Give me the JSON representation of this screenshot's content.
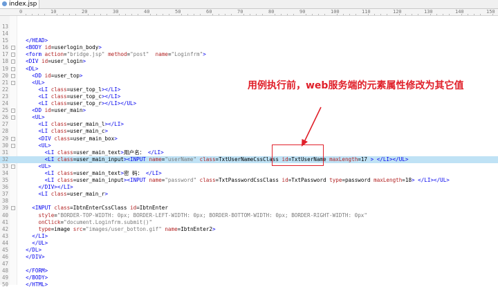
{
  "tab": {
    "filename": "index.jsp",
    "icon": "jsp-file-icon"
  },
  "ruler": {
    "ticks": [
      "0",
      "10",
      "20",
      "30",
      "40",
      "50",
      "60",
      "70",
      "80",
      "90",
      "100",
      "110",
      "120",
      "130",
      "140",
      "150"
    ]
  },
  "annotation": {
    "text": "用例执行前，web服务端的元素属性修改为其它值",
    "color": "#e0202a"
  },
  "highlight_color": "#bfe2f5",
  "lines": [
    {
      "num": "13",
      "fold": "",
      "html": ""
    },
    {
      "num": "14",
      "fold": "",
      "html": ""
    },
    {
      "num": "15",
      "fold": "",
      "html": "  <span class=\"t\">&lt;/HEAD&gt;</span>"
    },
    {
      "num": "16",
      "fold": "-",
      "html": "  <span class=\"t\">&lt;BODY</span> <span class=\"a\">id</span>=userlogin_body<span class=\"t\">&gt;</span>"
    },
    {
      "num": "17",
      "fold": "-",
      "html": "  <span class=\"t\">&lt;form</span> <span class=\"a\">action</span>=<span class=\"v\">\"bridge.jsp\"</span> <span class=\"a\">method</span>=<span class=\"v\">\"post\"</span>  <span class=\"a\">name</span>=<span class=\"v\">\"Loginfrm\"</span><span class=\"t\">&gt;</span>"
    },
    {
      "num": "18",
      "fold": "-",
      "html": "  <span class=\"t\">&lt;DIV</span> <span class=\"a\">id</span>=user_login<span class=\"t\">&gt;</span>"
    },
    {
      "num": "19",
      "fold": "-",
      "html": "  <span class=\"t\">&lt;DL&gt;</span>"
    },
    {
      "num": "20",
      "fold": "-",
      "html": "    <span class=\"t\">&lt;DD</span> <span class=\"a\">id</span>=user_top<span class=\"t\">&gt;</span>"
    },
    {
      "num": "21",
      "fold": "-",
      "html": "    <span class=\"t\">&lt;UL&gt;</span>"
    },
    {
      "num": "22",
      "fold": "",
      "html": "      <span class=\"t\">&lt;LI</span> <span class=\"a\">class</span>=user_top_l<span class=\"t\">&gt;&lt;/LI&gt;</span>"
    },
    {
      "num": "23",
      "fold": "",
      "html": "      <span class=\"t\">&lt;LI</span> <span class=\"a\">class</span>=user_top_c<span class=\"t\">&gt;&lt;/LI&gt;</span>"
    },
    {
      "num": "24",
      "fold": "",
      "html": "      <span class=\"t\">&lt;LI</span> <span class=\"a\">class</span>=user_top_r<span class=\"t\">&gt;&lt;/LI&gt;&lt;/UL&gt;</span>"
    },
    {
      "num": "25",
      "fold": "-",
      "html": "    <span class=\"t\">&lt;DD</span> <span class=\"a\">id</span>=user_main<span class=\"t\">&gt;</span>"
    },
    {
      "num": "26",
      "fold": "-",
      "html": "    <span class=\"t\">&lt;UL&gt;</span>"
    },
    {
      "num": "27",
      "fold": "",
      "html": "      <span class=\"t\">&lt;LI</span> <span class=\"a\">class</span>=user_main_l<span class=\"t\">&gt;&lt;/LI&gt;</span>"
    },
    {
      "num": "28",
      "fold": "",
      "html": "      <span class=\"t\">&lt;LI</span> <span class=\"a\">class</span>=user_main_c<span class=\"t\">&gt;</span>"
    },
    {
      "num": "29",
      "fold": "-",
      "html": "      <span class=\"t\">&lt;DIV</span> <span class=\"a\">class</span>=user_main_box<span class=\"t\">&gt;</span>"
    },
    {
      "num": "30",
      "fold": "-",
      "html": "      <span class=\"t\">&lt;UL&gt;</span>"
    },
    {
      "num": "31",
      "fold": "",
      "html": "        <span class=\"t\">&lt;LI</span> <span class=\"a\">class</span>=user_main_text<span class=\"t\">&gt;</span>用户名： <span class=\"t\">&lt;/LI&gt;</span>"
    },
    {
      "num": "32",
      "fold": "",
      "hl": true,
      "html": "        <span class=\"t\">&lt;LI</span> <span class=\"a\">class</span>=user_main_input<span class=\"t\">&gt;&lt;INPUT</span> <span class=\"a\">name</span>=<span class=\"v\">\"userName\"</span> <span class=\"a\">class</span>=TxtUserNameCssClass <span class=\"a\">id</span>=TxtUserName <span class=\"a\">maxLength</span>=17 <span class=\"t\">&gt; &lt;/LI&gt;&lt;/UL&gt;</span>"
    },
    {
      "num": "33",
      "fold": "-",
      "html": "      <span class=\"t\">&lt;UL&gt;</span>"
    },
    {
      "num": "34",
      "fold": "",
      "html": "        <span class=\"t\">&lt;LI</span> <span class=\"a\">class</span>=user_main_text<span class=\"t\">&gt;</span>密 码： <span class=\"t\">&lt;/LI&gt;</span>"
    },
    {
      "num": "35",
      "fold": "",
      "html": "        <span class=\"t\">&lt;LI</span> <span class=\"a\">class</span>=user_main_input<span class=\"t\">&gt;&lt;INPUT</span> <span class=\"a\">name</span>=<span class=\"v\">\"password\"</span> <span class=\"a\">class</span>=TxtPasswordCssClass <span class=\"a\">id</span>=TxtPassword <span class=\"a\">type</span>=password <span class=\"a\">maxLength</span>=18<span class=\"t\">&gt; &lt;/LI&gt;&lt;/UL&gt;</span>"
    },
    {
      "num": "36",
      "fold": "",
      "html": "      <span class=\"t\">&lt;/DIV&gt;&lt;/LI&gt;</span>"
    },
    {
      "num": "37",
      "fold": "",
      "html": "      <span class=\"t\">&lt;LI</span> <span class=\"a\">class</span>=user_main_r<span class=\"t\">&gt;</span>"
    },
    {
      "num": "38",
      "fold": "",
      "html": ""
    },
    {
      "num": "39",
      "fold": "-",
      "html": "    <span class=\"t\">&lt;INPUT</span> <span class=\"a\">class</span>=IbtnEnterCssClass <span class=\"a\">id</span>=IbtnEnter"
    },
    {
      "num": "40",
      "fold": "",
      "html": "      <span class=\"a\">style</span>=<span class=\"v\">\"BORDER-TOP-WIDTH: 0px; BORDER-LEFT-WIDTH: 0px; BORDER-BOTTOM-WIDTH: 0px; BORDER-RIGHT-WIDTH: 0px\"</span>"
    },
    {
      "num": "41",
      "fold": "",
      "html": "      <span class=\"a\">onClick</span>=<span class=\"v\">\"document.Loginfrm.submit()\"</span>"
    },
    {
      "num": "42",
      "fold": "",
      "html": "      <span class=\"a\">type</span>=image <span class=\"a\">src</span>=<span class=\"v\">\"images/user_botton.gif\"</span> <span class=\"a\">name</span>=IbtnEnter2<span class=\"t\">&gt;</span>"
    },
    {
      "num": "43",
      "fold": "",
      "html": "    <span class=\"t\">&lt;/LI&gt;</span>"
    },
    {
      "num": "44",
      "fold": "",
      "html": "    <span class=\"t\">&lt;/UL&gt;</span>"
    },
    {
      "num": "45",
      "fold": "",
      "html": "  <span class=\"t\">&lt;/DL&gt;</span>"
    },
    {
      "num": "46",
      "fold": "",
      "html": "  <span class=\"t\">&lt;/DIV&gt;</span>"
    },
    {
      "num": "47",
      "fold": "",
      "html": ""
    },
    {
      "num": "48",
      "fold": "",
      "html": "  <span class=\"t\">&lt;/FORM&gt;</span>"
    },
    {
      "num": "49",
      "fold": "",
      "html": "  <span class=\"t\">&lt;/BODY&gt;</span>"
    },
    {
      "num": "50",
      "fold": "",
      "html": "  <span class=\"t\">&lt;/HTML&gt;</span>"
    }
  ]
}
